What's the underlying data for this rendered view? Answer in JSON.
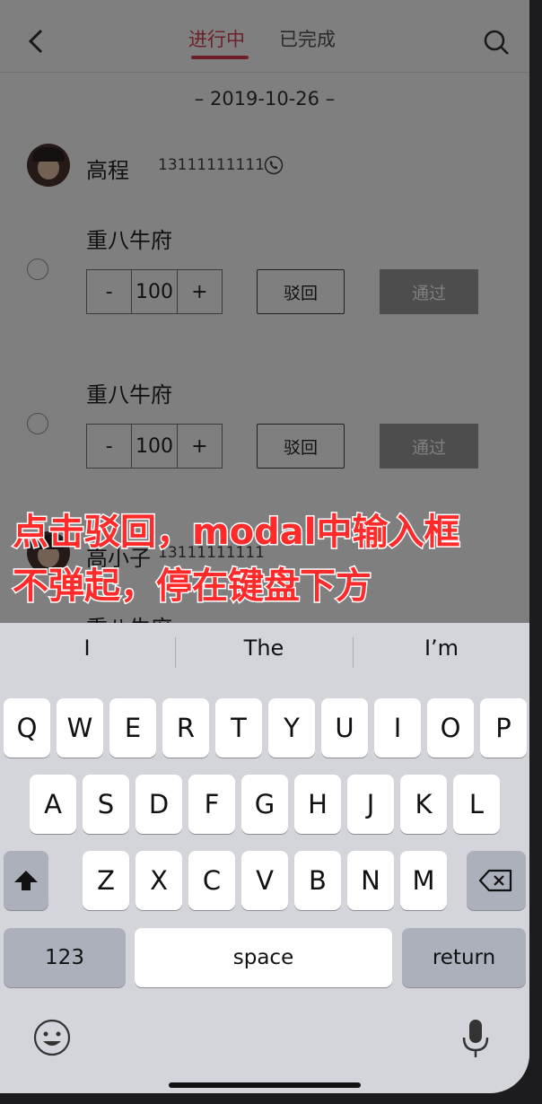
{
  "header": {
    "tab_active": "进行中",
    "tab_done": "已完成"
  },
  "date": "– 2019-10-26 –",
  "person1": {
    "name": "高程",
    "phone": "13111111111"
  },
  "orders": [
    {
      "shop": "重八牛府",
      "minus": "-",
      "qty": "100",
      "plus": "+",
      "reject": "驳回",
      "pass": "通过"
    },
    {
      "shop": "重八牛府",
      "minus": "-",
      "qty": "100",
      "plus": "+",
      "reject": "驳回",
      "pass": "通过"
    }
  ],
  "person2": {
    "name": "高小子",
    "phone": "13111111111"
  },
  "partial_shop": "重八牛府",
  "annotation": {
    "line1": "点击驳回，modal中输入框",
    "line2": "不弹起，停在键盘下方"
  },
  "keyboard": {
    "suggestions": [
      "I",
      "The",
      "I’m"
    ],
    "row1": [
      "Q",
      "W",
      "E",
      "R",
      "T",
      "Y",
      "U",
      "I",
      "O",
      "P"
    ],
    "row2": [
      "A",
      "S",
      "D",
      "F",
      "G",
      "H",
      "J",
      "K",
      "L"
    ],
    "row3": [
      "Z",
      "X",
      "C",
      "V",
      "B",
      "N",
      "M"
    ],
    "numbers": "123",
    "space": "space",
    "return": "return"
  },
  "colors": {
    "accent": "#d9414e",
    "annotation": "#ff2a2a"
  }
}
